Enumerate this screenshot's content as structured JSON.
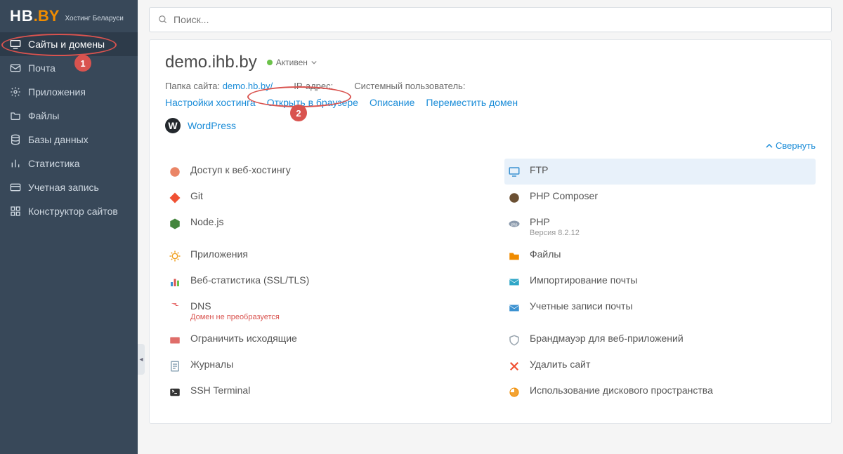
{
  "brand": {
    "hb": "HB",
    "dotby": ".BY",
    "sub": "Хостинг Беларуси"
  },
  "sidebar": {
    "items": [
      {
        "icon": "monitor",
        "label": "Сайты и домены",
        "active": true
      },
      {
        "icon": "mail",
        "label": "Почта"
      },
      {
        "icon": "gear",
        "label": "Приложения"
      },
      {
        "icon": "folder",
        "label": "Файлы"
      },
      {
        "icon": "database",
        "label": "Базы данных"
      },
      {
        "icon": "chart",
        "label": "Статистика"
      },
      {
        "icon": "card",
        "label": "Учетная запись"
      },
      {
        "icon": "grid",
        "label": "Конструктор сайтов"
      }
    ]
  },
  "search": {
    "placeholder": "Поиск..."
  },
  "domain": {
    "title": "demo.ihb.by",
    "status": "Активен",
    "meta": {
      "folder_label": "Папка сайта:",
      "folder_link": "demo.hb.by/",
      "ip_label": "IP-адрес:",
      "sysuser_label": "Системный пользователь:"
    },
    "links": {
      "hosting": "Настройки хостинга",
      "open": "Открыть в браузере",
      "desc": "Описание",
      "move": "Переместить домен"
    },
    "wp": "WordPress",
    "collapse": "Свернуть"
  },
  "tools": {
    "left": [
      {
        "icon": "hosting",
        "label": "Доступ к веб-хостингу",
        "color": "#e6704b"
      },
      {
        "icon": "git",
        "label": "Git",
        "color": "#f05133"
      },
      {
        "icon": "node",
        "label": "Node.js",
        "color": "#43853d"
      },
      {
        "icon": "apps",
        "label": "Приложения",
        "color": "#f0a020"
      },
      {
        "icon": "stats",
        "label": "Веб-статистика (SSL/TLS)",
        "color": "#3c92d1"
      },
      {
        "icon": "dns",
        "label": "DNS",
        "color": "#e24a4a",
        "sub": "Домен не преобразуется",
        "sub_err": true
      },
      {
        "icon": "restrict",
        "label": "Ограничить исходящие",
        "color": "#d9534f"
      },
      {
        "icon": "logs",
        "label": "Журналы",
        "color": "#8aa3b5"
      },
      {
        "icon": "ssh",
        "label": "SSH Terminal",
        "color": "#333"
      }
    ],
    "right": [
      {
        "icon": "ftp",
        "label": "FTP",
        "color": "#3c92d1",
        "highlight": true
      },
      {
        "icon": "composer",
        "label": "PHP Composer",
        "color": "#6b5033"
      },
      {
        "icon": "php",
        "label": "PHP",
        "color": "#8c9bad",
        "sub": "Версия 8.2.12"
      },
      {
        "icon": "files",
        "label": "Файлы",
        "color": "#f08c00"
      },
      {
        "icon": "import",
        "label": "Импортирование почты",
        "color": "#2fa6c7"
      },
      {
        "icon": "accounts",
        "label": "Учетные записи почты",
        "color": "#3c92d1"
      },
      {
        "icon": "waf",
        "label": "Брандмауэр для веб-приложений",
        "color": "#9aa5af"
      },
      {
        "icon": "delete",
        "label": "Удалить сайт",
        "color": "#f05133"
      },
      {
        "icon": "disk",
        "label": "Использование дискового пространства",
        "color": "#f08c00"
      }
    ]
  },
  "annotations": {
    "a1": "1",
    "a2": "2"
  }
}
